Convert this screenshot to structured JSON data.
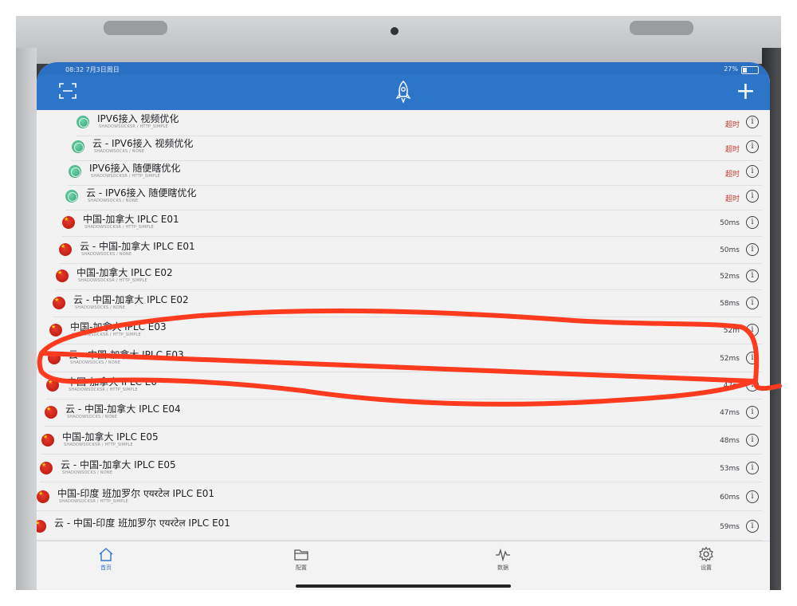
{
  "status_bar": {
    "time": "08:32  7月3日周日",
    "battery": "27%"
  },
  "nav": {
    "add_label": "+"
  },
  "servers": [
    {
      "name": "IPV6接入 视频优化",
      "protocol": "SHADOWSOCKSR / HTTP_SIMPLE",
      "latency": "超时",
      "icon": "globe-icon",
      "status": "timeout"
    },
    {
      "name": "云 - IPV6接入 视频优化",
      "protocol": "SHADOWSOCKS / NONE",
      "latency": "超时",
      "icon": "globe-icon",
      "status": "timeout"
    },
    {
      "name": "IPV6接入 随便瞎优化",
      "protocol": "SHADOWSOCKSR / HTTP_SIMPLE",
      "latency": "超时",
      "icon": "globe-icon",
      "status": "timeout"
    },
    {
      "name": "云 - IPV6接入 随便瞎优化",
      "protocol": "SHADOWSOCKS / NONE",
      "latency": "超时",
      "icon": "globe-icon",
      "status": "timeout"
    },
    {
      "name": "中国-加拿大 IPLC E01",
      "protocol": "SHADOWSOCKSR / HTTP_SIMPLE",
      "latency": "50ms",
      "icon": "china-flag-icon",
      "status": "ok"
    },
    {
      "name": "云 - 中国-加拿大 IPLC E01",
      "protocol": "SHADOWSOCKS / NONE",
      "latency": "50ms",
      "icon": "china-flag-icon",
      "status": "ok"
    },
    {
      "name": "中国-加拿大 IPLC E02",
      "protocol": "SHADOWSOCKSR / HTTP_SIMPLE",
      "latency": "52ms",
      "icon": "china-flag-icon",
      "status": "ok"
    },
    {
      "name": "云 - 中国-加拿大 IPLC E02",
      "protocol": "SHADOWSOCKS / NONE",
      "latency": "58ms",
      "icon": "china-flag-icon",
      "status": "ok"
    },
    {
      "name": "中国-加拿大 IPLC E03",
      "protocol": "SHADOWSOCKSR / HTTP_SIMPLE",
      "latency": "52m",
      "icon": "china-flag-icon",
      "status": "ok"
    },
    {
      "name": "云 - 中国-加拿大 IPLC E03",
      "protocol": "SHADOWSOCKS / NONE",
      "latency": "52ms",
      "icon": "china-flag-icon",
      "status": "ok"
    },
    {
      "name": "中国-加拿大 IPLC E0",
      "protocol": "SHADOWSOCKSR / HTTP_SIMPLE",
      "latency": "47m",
      "icon": "china-flag-icon",
      "status": "ok"
    },
    {
      "name": "云 - 中国-加拿大 IPLC E04",
      "protocol": "SHADOWSOCKS / NONE",
      "latency": "47ms",
      "icon": "china-flag-icon",
      "status": "ok"
    },
    {
      "name": "中国-加拿大 IPLC E05",
      "protocol": "SHADOWSOCKSR / HTTP_SIMPLE",
      "latency": "48ms",
      "icon": "china-flag-icon",
      "status": "ok"
    },
    {
      "name": "云 - 中国-加拿大 IPLC E05",
      "protocol": "SHADOWSOCKS / NONE",
      "latency": "53ms",
      "icon": "china-flag-icon",
      "status": "ok"
    },
    {
      "name": "中国-印度 班加罗尔 एयरटेल IPLC E01",
      "protocol": "SHADOWSOCKSR / HTTP_SIMPLE",
      "latency": "60ms",
      "icon": "china-flag-icon",
      "status": "ok"
    },
    {
      "name": "云 - 中国-印度 班加罗尔 एयरटेल IPLC E01",
      "protocol": "",
      "latency": "59ms",
      "icon": "china-flag-icon",
      "status": "ok"
    }
  ],
  "tabs": [
    {
      "label": "首页",
      "icon": "home-icon",
      "active": true
    },
    {
      "label": "配置",
      "icon": "folder-icon",
      "active": false
    },
    {
      "label": "数据",
      "icon": "waveform-icon",
      "active": false
    },
    {
      "label": "设置",
      "icon": "gear-icon",
      "active": false
    }
  ],
  "colors": {
    "nav_blue": "#2d75c8",
    "timeout_red": "#c43a2c",
    "annotation_red": "#ff3b1f"
  }
}
